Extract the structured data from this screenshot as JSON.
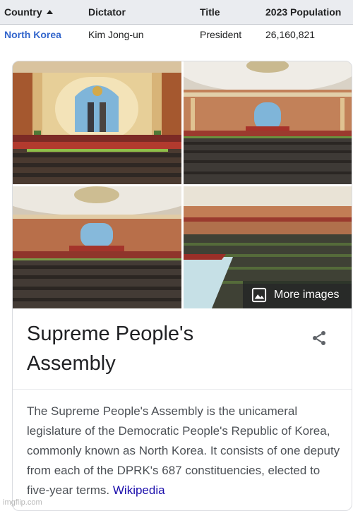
{
  "table": {
    "headers": [
      "Country",
      "Dictator",
      "Title",
      "2023 Population"
    ],
    "rows": [
      {
        "country": "North Korea",
        "dictator": "Kim Jong-un",
        "title": "President",
        "population": "26,160,821"
      }
    ]
  },
  "card": {
    "more_images_label": "More images",
    "title": "Supreme People's Assembly",
    "description": "The Supreme People's Assembly is the unicameral legislature of the Democratic People's Republic of Korea, commonly known as North Korea. It consists of one deputy from each of the DPRK's 687 constituencies, elected to five-year terms.",
    "source_label": "Wikipedia"
  },
  "watermark": "imgflip.com",
  "colors": {
    "link": "#3366cc",
    "source_link": "#1a0dab",
    "header_bg": "#eaecf0",
    "hall_red": "#a1362c",
    "hall_wood": "#b5653a"
  },
  "icons": {
    "sort": "sort-ascending-icon",
    "more_images": "image-icon",
    "share": "share-icon"
  }
}
